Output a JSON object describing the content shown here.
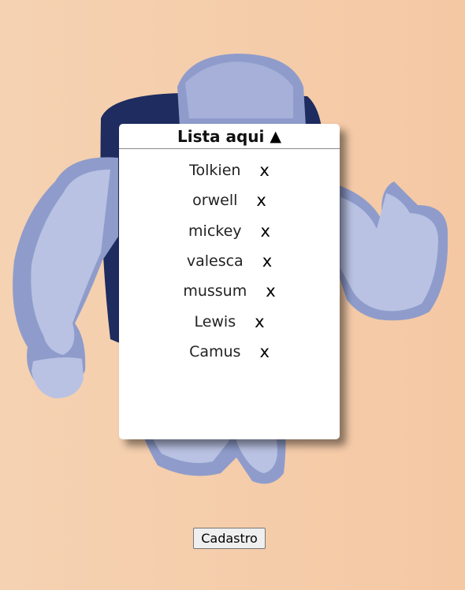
{
  "list": {
    "title": "Lista aqui",
    "toggle_icon": "▲",
    "remove_symbol": "x",
    "items": [
      {
        "name": "Tolkien"
      },
      {
        "name": "orwell"
      },
      {
        "name": "mickey"
      },
      {
        "name": "valesca"
      },
      {
        "name": "mussum"
      },
      {
        "name": "Lewis"
      },
      {
        "name": "Camus"
      }
    ]
  },
  "actions": {
    "cadastro_label": "Cadastro"
  },
  "colors": {
    "background_start": "#f5d2b2",
    "background_end": "#f5c8a4",
    "mascot_light": "#b9c2e3",
    "mascot_mid": "#8f9ccb",
    "mascot_dark": "#1e2c5f"
  },
  "icons": {
    "background": "strongman-mascot-illustration",
    "toggle": "triangle-up-icon",
    "remove": "close-x-icon"
  }
}
